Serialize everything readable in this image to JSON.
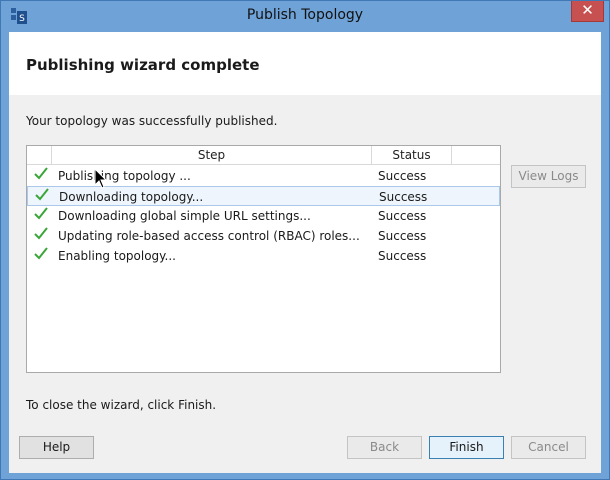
{
  "window": {
    "title": "Publish Topology",
    "close_glyph": "✕",
    "app_icon": "publish-topology-icon",
    "accent_color": "#6fa3d8"
  },
  "header": {
    "title": "Publishing wizard complete"
  },
  "main": {
    "success_message": "Your topology was successfully published.",
    "list": {
      "columns": [
        "",
        "Step",
        "Status",
        ""
      ],
      "rows": [
        {
          "step": "Publishing topology ...",
          "status": "Success",
          "icon": "check-icon"
        },
        {
          "step": "Downloading topology...",
          "status": "Success",
          "icon": "check-icon"
        },
        {
          "step": "Downloading global simple URL settings...",
          "status": "Success",
          "icon": "check-icon"
        },
        {
          "step": "Updating role-based access control (RBAC) roles...",
          "status": "Success",
          "icon": "check-icon"
        },
        {
          "step": "Enabling topology...",
          "status": "Success",
          "icon": "check-icon"
        }
      ],
      "selected_row": 1
    },
    "view_logs_label": "View Logs",
    "close_instruction": "To close the wizard, click Finish."
  },
  "footer": {
    "help_label": "Help",
    "back_label": "Back",
    "finish_label": "Finish",
    "cancel_label": "Cancel"
  }
}
